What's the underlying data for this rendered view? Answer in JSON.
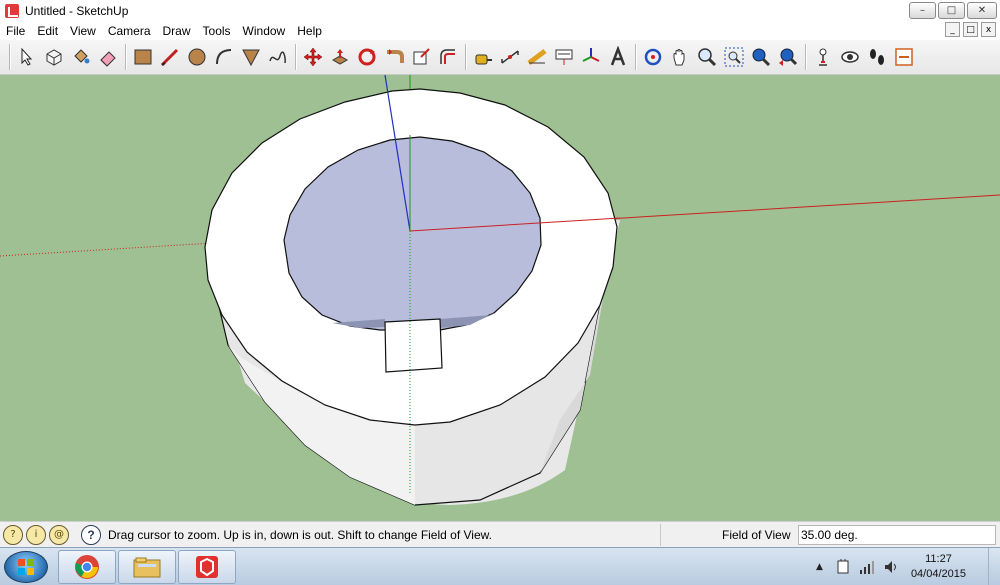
{
  "window": {
    "title": "Untitled - SketchUp",
    "controls": {
      "minimize": "–",
      "maximize": "□",
      "close": "✕"
    }
  },
  "menu": {
    "items": [
      "File",
      "Edit",
      "View",
      "Camera",
      "Draw",
      "Tools",
      "Window",
      "Help"
    ]
  },
  "mdi": {
    "minimize": "_",
    "restore": "□",
    "close": "x"
  },
  "toolbar": {
    "tools": [
      "select-icon",
      "make-component-icon",
      "paint-bucket-icon",
      "eraser-icon",
      "rectangle-icon",
      "line-icon",
      "circle-icon",
      "arc-icon",
      "polygon-icon",
      "freehand-icon",
      "move-icon",
      "push-pull-icon",
      "rotate-icon",
      "follow-me-icon",
      "scale-icon",
      "offset-icon",
      "tape-measure-icon",
      "dimension-icon",
      "protractor-icon",
      "text-icon",
      "axes-icon",
      "3d-text-icon",
      "orbit-icon",
      "pan-icon",
      "zoom-icon",
      "zoom-window-icon",
      "zoom-extents-icon",
      "previous-view-icon",
      "position-camera-icon",
      "look-around-icon",
      "walk-icon",
      "section-plane-icon"
    ]
  },
  "colors": {
    "viewport_bg": "#9ec092",
    "solid_face": "#ffffff",
    "inner_face": "#b7bddb",
    "axis_red": "#cc2020",
    "axis_green": "#1a9a1a",
    "axis_blue": "#2030c0"
  },
  "status": {
    "hint": "Drag cursor to zoom.  Up is in, down is out. Shift to change Field of View.",
    "vcb_label": "Field of View",
    "vcb_value": "35.00 deg."
  },
  "taskbar": {
    "apps": [
      "chrome-icon",
      "file-explorer-icon",
      "sketchup-icon"
    ],
    "clock_time": "11:27",
    "clock_date": "04/04/2015"
  }
}
